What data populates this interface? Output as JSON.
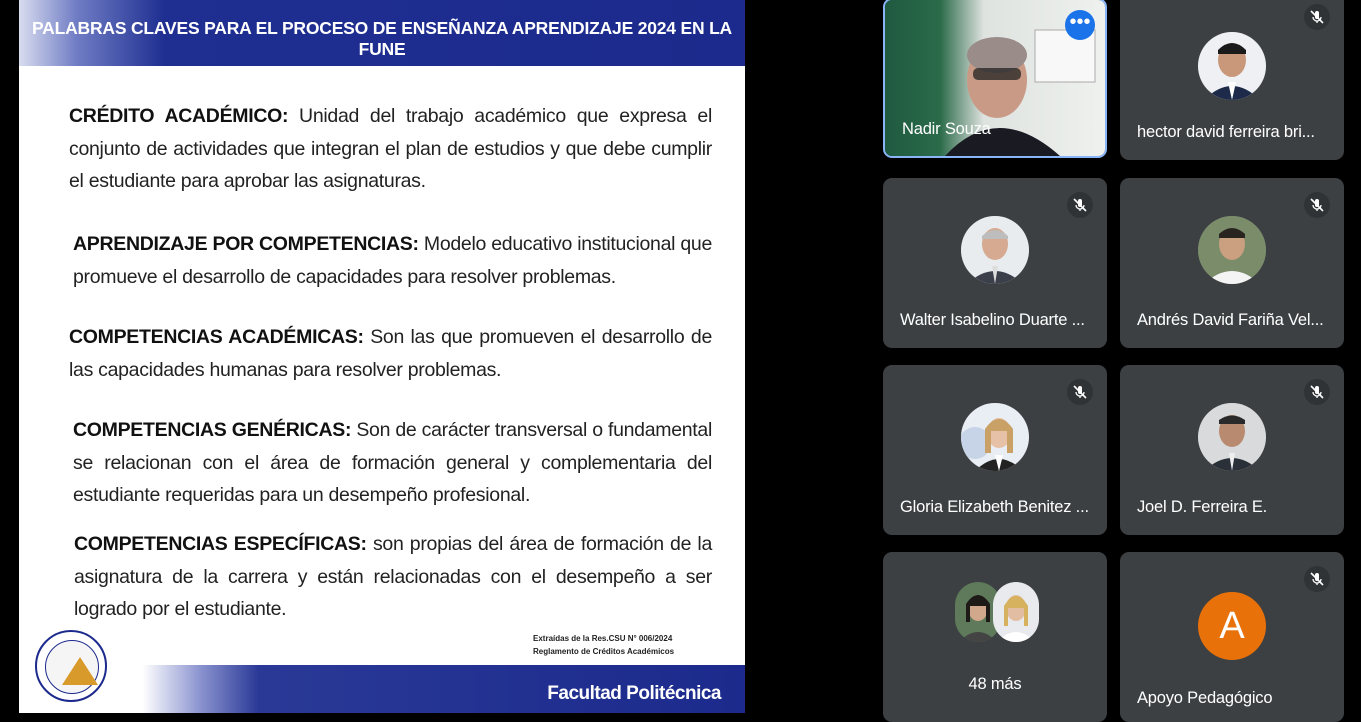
{
  "slide": {
    "title": "PALABRAS CLAVES  PARA EL PROCESO DE ENSEÑANZA APRENDIZAJE 2024 EN LA FUNE",
    "definitions": [
      {
        "term": "CRÉDITO ACADÉMICO:",
        "text": " Unidad del trabajo académico que expresa el conjunto de actividades que integran el plan de estudios y que debe cumplir el estudiante para aprobar las asignaturas."
      },
      {
        "term": "APRENDIZAJE POR COMPETENCIAS:",
        "text": " Modelo educativo institucional que promueve el desarrollo de capacidades para resolver problemas."
      },
      {
        "term": "COMPETENCIAS ACADÉMICAS:",
        "text": " Son las que promueven el desarrollo de las capacidades humanas para resolver problemas."
      },
      {
        "term": "COMPETENCIAS GENÉRICAS:",
        "text": " Son de carácter transversal o fundamental se relacionan con el área de formación general y complementaria del estudiante requeridas para un desempeño profesional."
      },
      {
        "term": "COMPETENCIAS ESPECÍFICAS:",
        "text": " son propias del área de formación de la asignatura de la carrera y están relacionadas con el desempeño a ser logrado por el estudiante."
      }
    ],
    "source_line1": "Extraídas de la Res.CSU N° 006/2024",
    "source_line2": "Reglamento de Créditos Académicos",
    "footer": "Facultad Politécnica"
  },
  "participants": [
    {
      "name": "Nadir Souza",
      "muted": false,
      "active": true
    },
    {
      "name": "hector david ferreira bri...",
      "muted": true
    },
    {
      "name": "Walter Isabelino Duarte ...",
      "muted": true
    },
    {
      "name": "Andrés David Fariña Vel...",
      "muted": true
    },
    {
      "name": "Gloria Elizabeth Benitez ...",
      "muted": true
    },
    {
      "name": "Joel D. Ferreira E.",
      "muted": true
    },
    {
      "name": "48 más",
      "muted": false
    },
    {
      "name": "Apoyo Pedagógico",
      "muted": true,
      "initial": "A"
    }
  ],
  "colors": {
    "slide_header": "#1b2a8c",
    "tile_bg": "#3c4043",
    "active_border": "#8ab4f8",
    "more_button": "#1a73e8",
    "initial_avatar": "#e8710a"
  },
  "icons": {
    "mute": "mic-off-icon",
    "more": "more-options-icon"
  }
}
